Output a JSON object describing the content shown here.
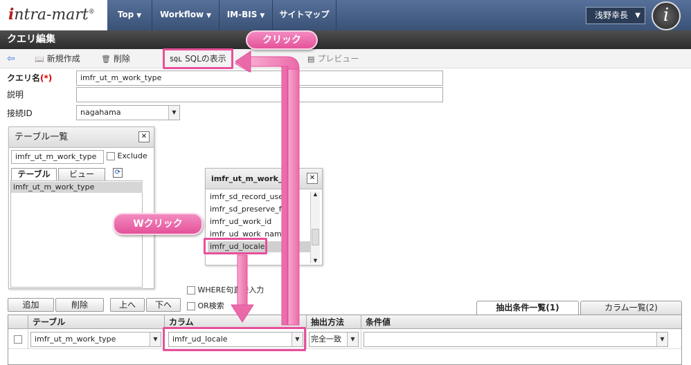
{
  "header": {
    "logo": "intra-mart",
    "logo_mark": "®",
    "nav": [
      {
        "label": "Top",
        "caret": "▼"
      },
      {
        "label": "Workflow",
        "caret": "▼"
      },
      {
        "label": "IM-BIS",
        "caret": "▼"
      },
      {
        "label": "サイトマップ",
        "caret": ""
      }
    ],
    "user": "浅野幸長",
    "avatar": "i"
  },
  "page_title": "クエリ編集",
  "toolbar": {
    "new": "新規作成",
    "delete": "削除",
    "sql_icon": "SQL",
    "sql_show": "SQLの表示",
    "preview": "プレビュー"
  },
  "form": {
    "query_name_label": "クエリ名",
    "required_mark": "(*)",
    "query_name_value": "imfr_ut_m_work_type",
    "desc_label": "説明",
    "desc_value": "",
    "conn_label": "接続ID",
    "conn_value": "nagahama"
  },
  "table_list": {
    "title": "テーブル一覧",
    "filter_value": "imfr_ut_m_work_type",
    "exclude_label": "Exclude",
    "tab_table": "テーブル",
    "tab_view": "ビュー",
    "refresh_icon": "⟳",
    "items": [
      "imfr_ut_m_work_type"
    ]
  },
  "column_popup": {
    "title": "imfr_ut_m_work_typ",
    "items": [
      "imfr_sd_record_user_cd",
      "imfr_sd_preserve_flag",
      "imfr_ud_work_id",
      "imfr_ud_work_name",
      "imfr_ud_locale"
    ],
    "selected_index": 4
  },
  "options": {
    "where_label": "WHERE句直接入力",
    "or_label": "OR検索"
  },
  "buttons": {
    "add": "追加",
    "delete": "削除",
    "up": "上へ",
    "down": "下へ"
  },
  "tabs": {
    "conditions": "抽出条件一覧(1)",
    "columns": "カラム一覧(2)"
  },
  "grid": {
    "headers": [
      "テーブル",
      "カラム",
      "抽出方法",
      "条件値"
    ],
    "rows": [
      {
        "table": "imfr_ut_m_work_type",
        "column": "imfr_ud_locale",
        "method": "完全一致",
        "value": ""
      }
    ]
  },
  "callouts": {
    "click": "クリック",
    "wclick": "Wクリック"
  },
  "colors": {
    "accent_pink": "#e84f9a",
    "header_blue": "#4a6289"
  }
}
